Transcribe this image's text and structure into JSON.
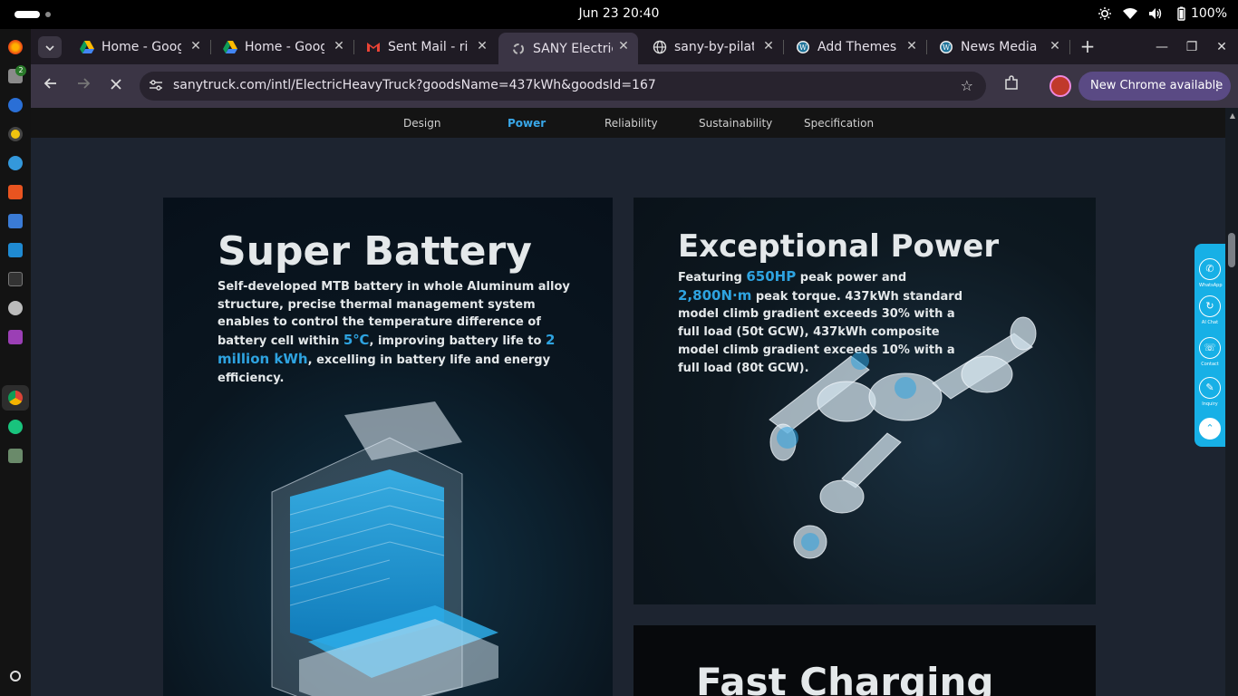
{
  "system_bar": {
    "clock": "Jun 23  20:40",
    "battery": "100%"
  },
  "browser": {
    "tabs": [
      {
        "title": "Home - Goog",
        "favicon": "google-drive-icon"
      },
      {
        "title": "Home - Goog",
        "favicon": "google-drive-icon"
      },
      {
        "title": "Sent Mail - ric",
        "favicon": "gmail-icon"
      },
      {
        "title": "SANY Electric",
        "favicon": "sany-icon",
        "active": true
      },
      {
        "title": "sany-by-pilat",
        "favicon": "globe-icon"
      },
      {
        "title": "Add Themes",
        "favicon": "wordpress-icon"
      },
      {
        "title": "News Media",
        "favicon": "wordpress-icon"
      }
    ],
    "url": "sanytruck.com/intl/ElectricHeavyTruck?goodsName=437kWh&goodsId=167",
    "update_chip": "New Chrome available",
    "dock_badge": "2"
  },
  "page": {
    "subnav": [
      "Design",
      "Power",
      "Reliability",
      "Sustainability",
      "Specification"
    ],
    "subnav_active": "Power",
    "battery": {
      "title": "Super Battery",
      "text_1": "Self-developed MTB battery in whole Aluminum alloy structure, precise thermal management system enables to control the temperature difference of battery cell within ",
      "hl_1": "5℃",
      "text_2": ", improving battery life to ",
      "hl_2": "2 million kWh",
      "text_3": ", excelling in battery life and energy efficiency."
    },
    "power": {
      "title": "Exceptional Power",
      "text_1": "Featuring ",
      "hl_1": "650HP",
      "text_2": " peak power and ",
      "hl_2": "2,800N·m",
      "text_3": " peak torque. 437kWh standard model climb gradient exceeds 30% with a full load (50t GCW), 437kWh composite model climb gradient exceeds 10% with a full load (80t GCW)."
    },
    "charging": {
      "title": "Fast Charging"
    },
    "contact_bar": [
      "WhatsApp",
      "AI Chat",
      "Contact",
      "Inquiry"
    ]
  },
  "colors": {
    "accent": "#2ea3e0",
    "contact_bar": "#17b0e6",
    "page_bg": "#1d2430"
  }
}
